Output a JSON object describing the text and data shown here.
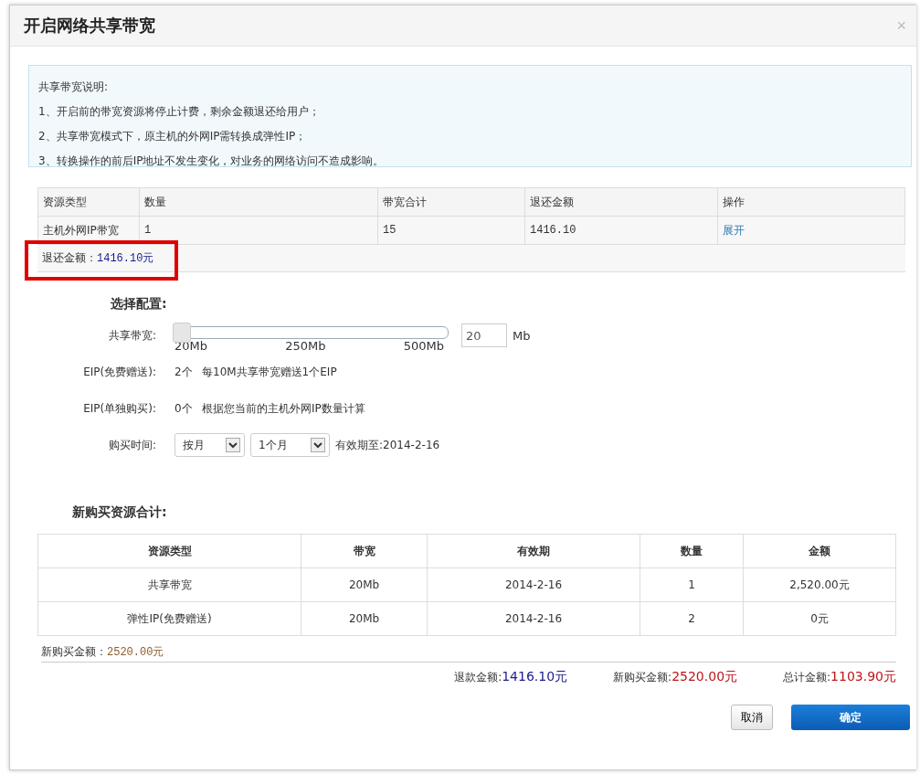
{
  "dialog": {
    "title": "开启网络共享带宽",
    "close": "×"
  },
  "notice": {
    "heading": "共享带宽说明:",
    "lines": [
      "1、开启前的带宽资源将停止计费，剩余金额退还给用户；",
      "2、共享带宽模式下，原主机的外网IP需转换成弹性IP；",
      "3、转换操作的前后IP地址不发生变化，对业务的网络访问不造成影响。"
    ]
  },
  "refund_table": {
    "columns": [
      "资源类型",
      "数量",
      "带宽合计",
      "退还金额",
      "操作"
    ],
    "rows": [
      {
        "cells": [
          "主机外网IP带宽",
          "1",
          "15",
          "1416.10"
        ],
        "action": "展开"
      }
    ],
    "summary_label": "退还金额：",
    "summary_value": "1416.10元"
  },
  "config": {
    "heading": "选择配置:",
    "bandwidth": {
      "label": "共享带宽:",
      "level": 0,
      "ticks": [
        "20Mb",
        "250Mb",
        "500Mb"
      ],
      "value": "20",
      "unit": "Mb"
    },
    "eip_free": {
      "label": "EIP(免费赠送):",
      "count": "2个",
      "note": "每10M共享带宽赠送1个EIP"
    },
    "eip_paid": {
      "label": "EIP(单独购买):",
      "count": "0个",
      "note": "根据您当前的主机外网IP数量计算"
    },
    "period": {
      "label": "购买时间:",
      "unit_select": "按月",
      "length_select": "1个月",
      "expiry": "有效期至:2014-2-16"
    }
  },
  "purchase": {
    "heading": "新购买资源合计:",
    "columns": [
      "资源类型",
      "带宽",
      "有效期",
      "数量",
      "金额"
    ],
    "rows": [
      [
        "共享带宽",
        "20Mb",
        "2014-2-16",
        "1",
        "2,520.00元"
      ],
      [
        "弹性IP(免费赠送)",
        "20Mb",
        "2014-2-16",
        "2",
        "0元"
      ]
    ],
    "summary_label": "新购买金额：",
    "summary_value": "2520.00元"
  },
  "totals": [
    {
      "label": "退款金额:",
      "value": "1416.10元",
      "color": "#1a1a8c"
    },
    {
      "label": "新购买金额:",
      "value": "2520.00元",
      "color": "#c0141c"
    },
    {
      "label": "总计金额:",
      "value": "1103.90元",
      "color": "#c0141c"
    }
  ],
  "buttons": {
    "cancel": "取消",
    "confirm": "确定"
  }
}
